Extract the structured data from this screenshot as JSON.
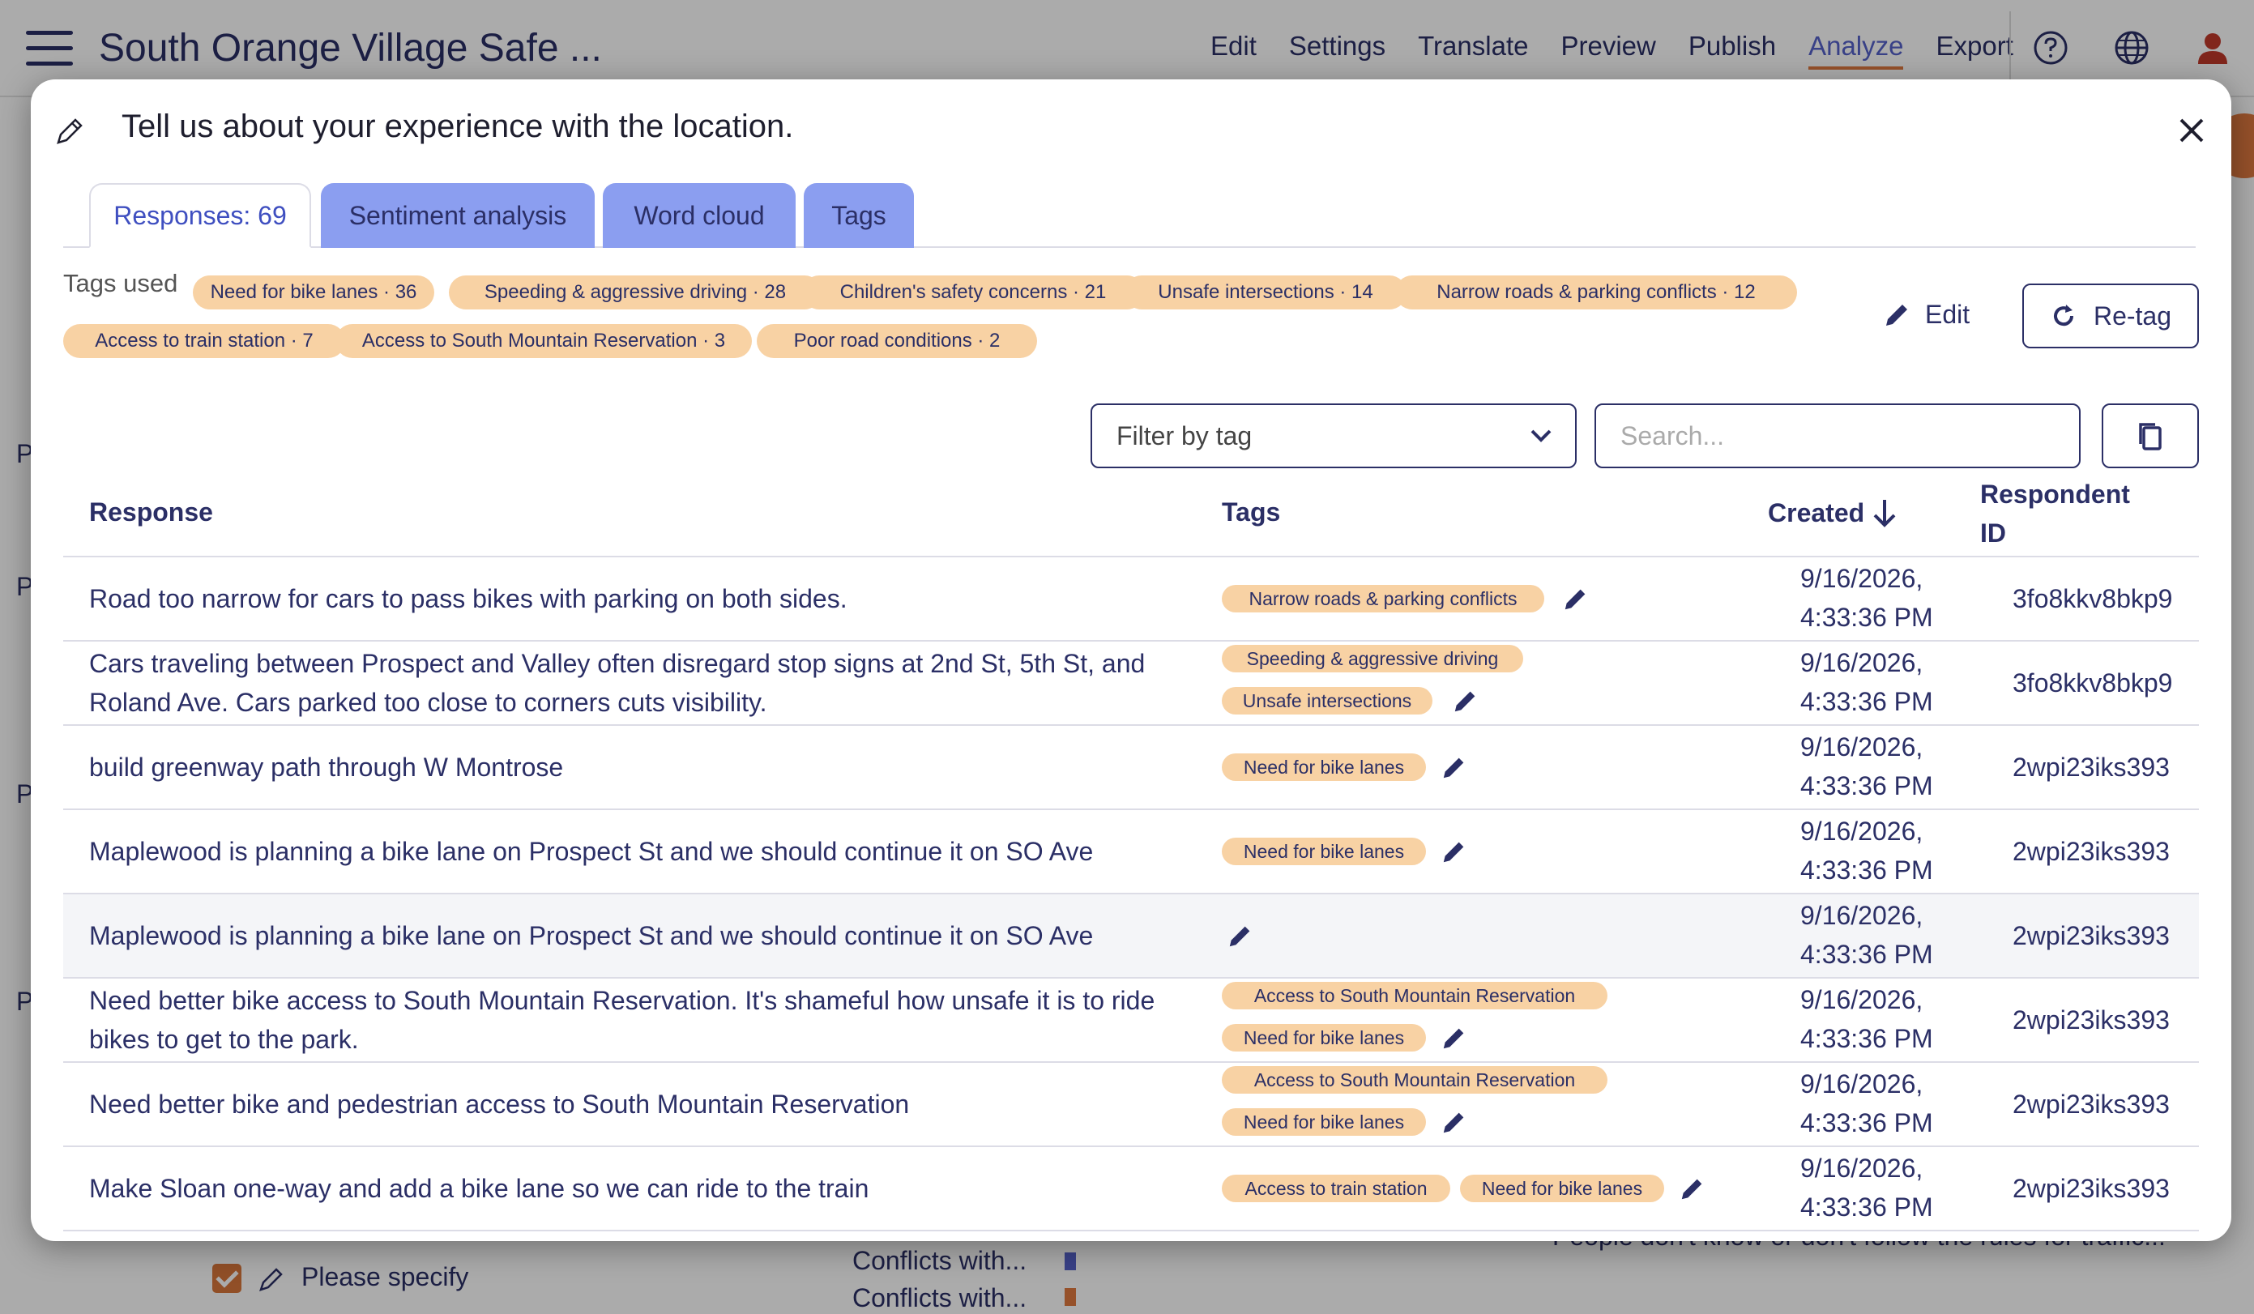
{
  "app": {
    "title": "South Orange Village Safe ...",
    "nav": [
      "Edit",
      "Settings",
      "Translate",
      "Preview",
      "Publish",
      "Analyze",
      "Export"
    ],
    "active_nav": "Analyze",
    "icons": [
      "help-icon",
      "globe-icon",
      "user-icon"
    ]
  },
  "background": {
    "left_labels": [
      "P",
      "P",
      "P",
      "P"
    ],
    "checkbox_label": "Please specify",
    "mid_labels": [
      "Conflicts with...",
      "Conflicts with..."
    ],
    "right_text": "People don't know or don't follow the rules for traffic..."
  },
  "modal": {
    "title": "Tell us about your experience with the location.",
    "tabs": [
      {
        "label": "Responses: 69",
        "active": true
      },
      {
        "label": "Sentiment analysis",
        "active": false
      },
      {
        "label": "Word cloud",
        "active": false
      },
      {
        "label": "Tags",
        "active": false
      }
    ],
    "tags_used_label": "Tags used",
    "tags_used": [
      "Need for bike lanes · 36",
      "Speeding & aggressive driving · 28",
      "Children's safety concerns · 21",
      "Unsafe intersections · 14",
      "Narrow roads & parking conflicts · 12",
      "Access to train station · 7",
      "Access to South Mountain Reservation · 3",
      "Poor road conditions · 2"
    ],
    "edit_label": "Edit",
    "retag_label": "Re-tag",
    "filter_placeholder": "Filter by tag",
    "search_placeholder": "Search...",
    "columns": {
      "response": "Response",
      "tags": "Tags",
      "created": "Created",
      "respondent_line1": "Respondent",
      "respondent_line2": "ID"
    },
    "rows": [
      {
        "response": "Road too narrow for cars to pass bikes with parking on both sides.",
        "tags": [
          "Narrow roads & parking conflicts"
        ],
        "created_date": "9/16/2026,",
        "created_time": "4:33:36 PM",
        "id": "3fo8kkv8bkp9"
      },
      {
        "response": "Cars traveling between Prospect and Valley often disregard stop signs at 2nd St, 5th St, and Roland Ave. Cars parked too close to corners cuts visibility.",
        "tags": [
          "Speeding & aggressive driving",
          "Unsafe intersections"
        ],
        "created_date": "9/16/2026,",
        "created_time": "4:33:36 PM",
        "id": "3fo8kkv8bkp9"
      },
      {
        "response": "build greenway path through W Montrose",
        "tags": [
          "Need for bike lanes"
        ],
        "created_date": "9/16/2026,",
        "created_time": "4:33:36 PM",
        "id": "2wpi23iks393"
      },
      {
        "response": "Maplewood is planning a bike lane on Prospect St and we should continue it on SO Ave",
        "tags": [
          "Need for bike lanes"
        ],
        "created_date": "9/16/2026,",
        "created_time": "4:33:36 PM",
        "id": "2wpi23iks393"
      },
      {
        "response": "Maplewood is planning a bike lane on Prospect St and we should continue it on SO Ave",
        "tags": [],
        "created_date": "9/16/2026,",
        "created_time": "4:33:36 PM",
        "id": "2wpi23iks393"
      },
      {
        "response": "Need better bike access to South Mountain Reservation. It's shameful how unsafe it is to ride bikes to get to the park.",
        "tags": [
          "Access to South Mountain Reservation",
          "Need for bike lanes"
        ],
        "created_date": "9/16/2026,",
        "created_time": "4:33:36 PM",
        "id": "2wpi23iks393"
      },
      {
        "response": "Need better bike and pedestrian access to South Mountain Reservation",
        "tags": [
          "Access to South Mountain Reservation",
          "Need for bike lanes"
        ],
        "created_date": "9/16/2026,",
        "created_time": "4:33:36 PM",
        "id": "2wpi23iks393"
      },
      {
        "response": "Make Sloan one-way and add a bike lane so we can ride to the train",
        "tags": [
          "Access to train station",
          "Need for bike lanes"
        ],
        "created_date": "9/16/2026,",
        "created_time": "4:33:36 PM",
        "id": "2wpi23iks393"
      }
    ]
  },
  "colors": {
    "accent": "#3f4fc0",
    "tab_inactive": "#8b9ef0",
    "chip": "#f8d2a4",
    "text": "#2b2f66",
    "highlight_row": "#f4f5f8"
  }
}
